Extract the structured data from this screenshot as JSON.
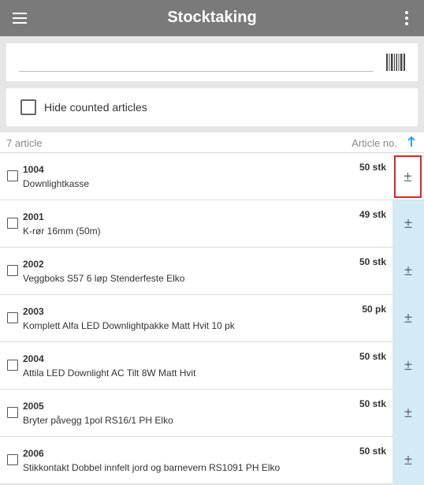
{
  "appbar": {
    "title": "Stocktaking",
    "menu_icon": "hamburger-menu-icon",
    "more_icon": "more-vertical-icon"
  },
  "search": {
    "value": "",
    "placeholder": "",
    "scan_icon": "barcode-icon"
  },
  "filter": {
    "label": "Hide counted articles",
    "checked": false
  },
  "list_header": {
    "count_text": "7 article",
    "sort_label": "Article no.",
    "sort_icon": "arrow-up-icon",
    "accent": "#2196f3"
  },
  "adjust_label": "±",
  "articles": [
    {
      "number": "1004",
      "name": "Downlightkasse",
      "quantity": "50 stk"
    },
    {
      "number": "2001",
      "name": "K-rør 16mm (50m)",
      "quantity": "49 stk"
    },
    {
      "number": "2002",
      "name": "Veggboks S57 6 løp Stenderfeste Elko",
      "quantity": "50 stk"
    },
    {
      "number": "2003",
      "name": "Komplett Alfa LED Downlightpakke Matt Hvit 10 pk",
      "quantity": "50 pk"
    },
    {
      "number": "2004",
      "name": "Attila LED Downlight AC Tilt 8W Matt Hvit",
      "quantity": "50 stk"
    },
    {
      "number": "2005",
      "name": "Bryter påvegg 1pol RS16/1 PH Elko",
      "quantity": "50 stk"
    },
    {
      "number": "2006",
      "name": "Stikkontakt Dobbel innfelt jord og barnevern RS1091 PH Elko",
      "quantity": "50 stk"
    }
  ],
  "colors": {
    "appbar": "#7a7a7a",
    "background": "#e6e6e6",
    "adjust_bg": "#d3ebf5",
    "highlight_border": "#d62828"
  }
}
